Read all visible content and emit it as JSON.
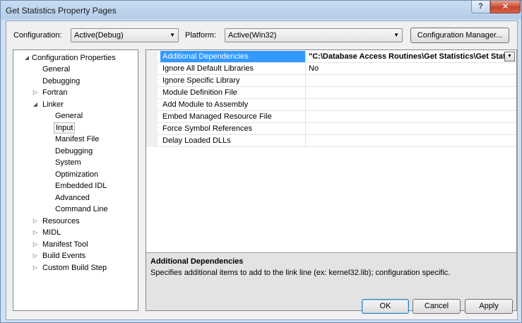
{
  "window": {
    "title": "Get Statistics Property Pages",
    "help_glyph": "?",
    "close_glyph": "✕"
  },
  "toolbar": {
    "configuration_label": "Configuration:",
    "configuration_value": "Active(Debug)",
    "platform_label": "Platform:",
    "platform_value": "Active(Win32)",
    "config_manager_label": "Configuration Manager..."
  },
  "tree": {
    "root": "Configuration Properties",
    "items": [
      {
        "label": "General"
      },
      {
        "label": "Debugging"
      },
      {
        "label": "Fortran"
      },
      {
        "label": "Linker"
      },
      {
        "label": "General"
      },
      {
        "label": "Input"
      },
      {
        "label": "Manifest File"
      },
      {
        "label": "Debugging"
      },
      {
        "label": "System"
      },
      {
        "label": "Optimization"
      },
      {
        "label": "Embedded IDL"
      },
      {
        "label": "Advanced"
      },
      {
        "label": "Command Line"
      },
      {
        "label": "Resources"
      },
      {
        "label": "MIDL"
      },
      {
        "label": "Manifest Tool"
      },
      {
        "label": "Build Events"
      },
      {
        "label": "Custom Build Step"
      }
    ]
  },
  "grid": {
    "rows": [
      {
        "name": "Additional Dependencies",
        "value": "\"C:\\Database Access Routines\\Get Statistics\\Get Statist"
      },
      {
        "name": "Ignore All Default Libraries",
        "value": "No"
      },
      {
        "name": "Ignore Specific Library",
        "value": ""
      },
      {
        "name": "Module Definition File",
        "value": ""
      },
      {
        "name": "Add Module to Assembly",
        "value": ""
      },
      {
        "name": "Embed Managed Resource File",
        "value": ""
      },
      {
        "name": "Force Symbol References",
        "value": ""
      },
      {
        "name": "Delay Loaded DLLs",
        "value": ""
      }
    ]
  },
  "description": {
    "title": "Additional Dependencies",
    "text": "Specifies additional items to add to the link line (ex: kernel32.lib); configuration specific."
  },
  "footer": {
    "ok_label": "OK",
    "cancel_label": "Cancel",
    "apply_label": "Apply"
  }
}
